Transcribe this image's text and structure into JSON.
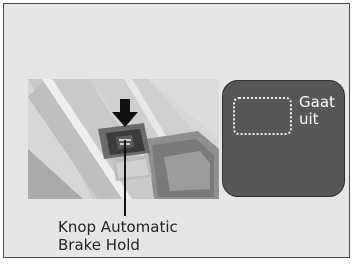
{
  "indicator": {
    "line1": "Gaat",
    "line2": "uit"
  },
  "callout": {
    "line1": "Knop Automatic",
    "line2": "Brake Hold"
  }
}
